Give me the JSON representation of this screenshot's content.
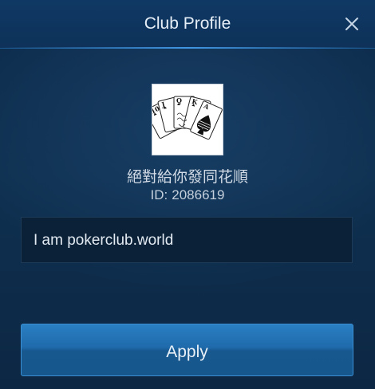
{
  "dialog": {
    "title": "Club Profile",
    "close_icon": "close-icon"
  },
  "club": {
    "logo_icon": "playing-cards-logo",
    "name": "絕對給你發同花順",
    "id_label": "ID:",
    "id_value": "2086619",
    "description": "I am pokerclub.world"
  },
  "actions": {
    "apply_label": "Apply"
  },
  "colors": {
    "background": "#0e2844",
    "header": "#0f3864",
    "accent": "#2a7fc3",
    "text": "#e6eef7"
  }
}
